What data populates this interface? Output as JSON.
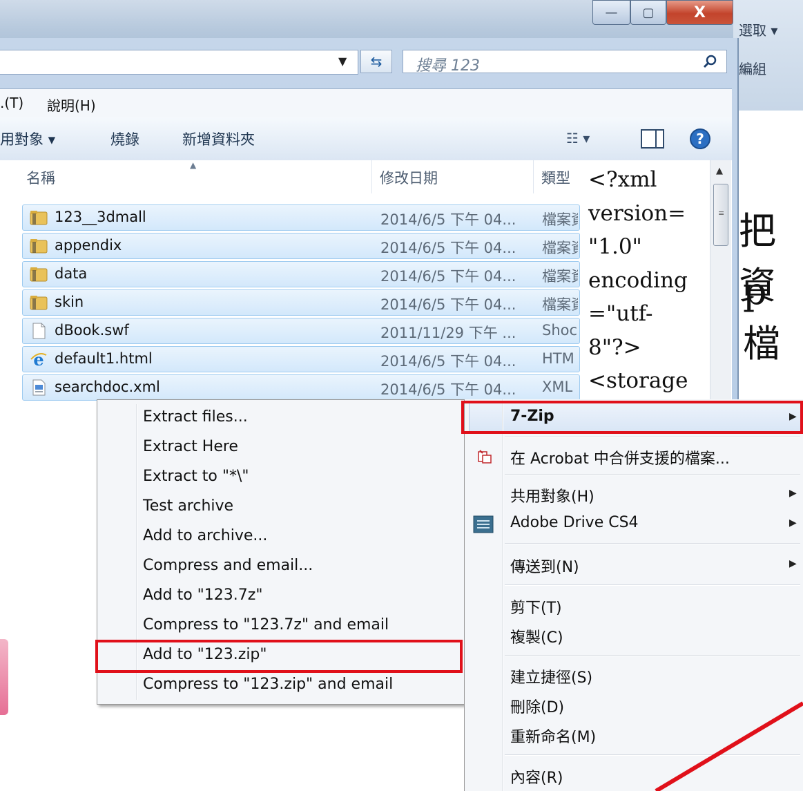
{
  "background": {
    "ribbon_labels": [
      "選取 ▾",
      "編組"
    ],
    "doc_text_fragments": [
      "把資",
      "p檔"
    ]
  },
  "window": {
    "caption": {
      "minimize": "—",
      "maximize": "▢",
      "close": "X"
    },
    "search": {
      "placeholder": "搜尋 123"
    },
    "menubar": {
      "items": [
        ".(T)",
        "說明(H)"
      ]
    },
    "toolbar": {
      "share": "用對象 ▾",
      "burn": "燒錄",
      "new_folder": "新增資料夾"
    },
    "columns": {
      "name": "名稱",
      "date": "修改日期",
      "type": "類型"
    },
    "files": [
      {
        "name": "123__3dmall",
        "date": "2014/6/5 下午 04...",
        "type": "檔案資",
        "icon": "folder-icon"
      },
      {
        "name": "appendix",
        "date": "2014/6/5 下午 04...",
        "type": "檔案資",
        "icon": "folder-icon"
      },
      {
        "name": "data",
        "date": "2014/6/5 下午 04...",
        "type": "檔案資",
        "icon": "folder-icon"
      },
      {
        "name": "skin",
        "date": "2014/6/5 下午 04...",
        "type": "檔案資",
        "icon": "folder-icon"
      },
      {
        "name": "dBook.swf",
        "date": "2011/11/29 下午 ...",
        "type": "Shoc",
        "icon": "file-icon"
      },
      {
        "name": "default1.html",
        "date": "2014/6/5 下午 04...",
        "type": "HTM",
        "icon": "ie-icon"
      },
      {
        "name": "searchdoc.xml",
        "date": "2014/6/5 下午 04...",
        "type": "XML",
        "icon": "xml-file-icon"
      }
    ],
    "preview_text": "<?xml\nversion=\n\"1.0\"\nencoding\n=\"utf-\n8\"?>\n<storage"
  },
  "zip_submenu": {
    "items": [
      "Extract files...",
      "Extract Here",
      "Extract to \"*\\\"",
      "Test archive",
      "Add to archive...",
      "Compress and email...",
      "Add to \"123.7z\"",
      "Compress to \"123.7z\" and email",
      "Add to \"123.zip\"",
      "Compress to \"123.zip\" and email"
    ],
    "highlighted": "Add to \"123.zip\""
  },
  "context_menu": {
    "zip": "7-Zip",
    "acrobat": "在 Acrobat 中合併支援的檔案...",
    "share": "共用對象(H)",
    "adobe_drive": "Adobe Drive CS4",
    "send_to": "傳送到(N)",
    "cut": "剪下(T)",
    "copy": "複製(C)",
    "shortcut": "建立捷徑(S)",
    "delete": "刪除(D)",
    "rename": "重新命名(M)",
    "properties": "內容(R)"
  },
  "colors": {
    "highlight_red": "#e0101a",
    "selection_blue": "#d3e8fb"
  }
}
